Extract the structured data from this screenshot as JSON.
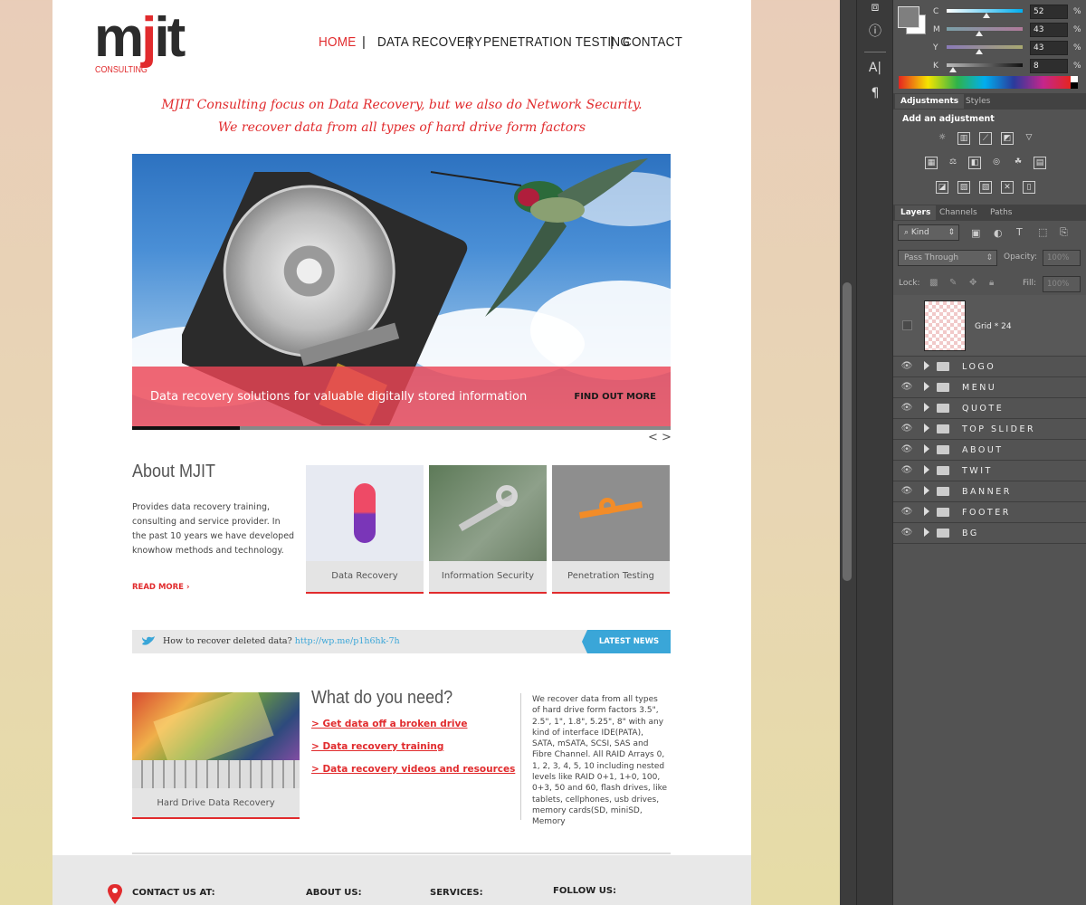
{
  "site": {
    "logo": {
      "main": "mjit",
      "sub": "CONSULTING"
    },
    "nav": [
      "HOME",
      "DATA RECOVERY",
      "PENETRATION TESTING",
      "CONTACT"
    ],
    "nav_separator": "|",
    "quote": [
      "MJIT Consulting focus on Data Recovery, but we also do Network Security.",
      "We recover data from all types of hard drive form factors"
    ],
    "slider": {
      "caption": "Data recovery solutions for valuable digitally stored information",
      "button": "FIND OUT MORE",
      "arrows": "< >",
      "progress": 0.2
    },
    "about": {
      "title": "About MJIT",
      "text": "Provides data recovery training, consulting and service provider. In the past 10 years we have developed knowhow methods and technology.",
      "read_more": "READ MORE",
      "tiles": [
        "Data Recovery",
        "Information Security",
        "Penetration Testing"
      ]
    },
    "twitter": {
      "text": "How to recover deleted data?",
      "link": "http://wp.me/p1h6hk-7h",
      "button": "LATEST NEWS"
    },
    "what": {
      "image_label": "Hard Drive Data Recovery",
      "title": "What do you need?",
      "links": [
        "> Get data off a broken drive",
        "> Data recovery training",
        "> Data recovery videos and resources"
      ],
      "body": "We recover data from all types of hard drive form factors 3.5\", 2.5\", 1\", 1.8\", 5.25\", 8\" with any kind of interface IDE(PATA), SATA, mSATA, SCSI, SAS and Fibre Channel. All RAID Arrays 0, 1, 2, 3, 4, 5, 10 including nested levels like RAID 0+1, 1+0, 100, 0+3, 50 and 60, flash drives, like tablets, cellphones, usb drives, memory cards(SD, miniSD, Memory"
    },
    "footer": [
      "CONTACT US AT:",
      "ABOUT US:",
      "SERVICES:",
      "FOLLOW US:"
    ]
  },
  "photoshop": {
    "color": {
      "channels": [
        {
          "label": "C",
          "value": "52",
          "level": 0.52
        },
        {
          "label": "M",
          "value": "43",
          "level": 0.43
        },
        {
          "label": "Y",
          "value": "43",
          "level": 0.43
        },
        {
          "label": "K",
          "value": "8",
          "level": 0.08
        }
      ],
      "unit": "%"
    },
    "adjustments": {
      "tabs": [
        "Adjustments",
        "Styles"
      ],
      "heading": "Add an adjustment"
    },
    "layers_panel": {
      "tabs": [
        "Layers",
        "Channels",
        "Paths"
      ],
      "kind": "Kind",
      "blend_mode": "Pass Through",
      "opacity_label": "Opacity:",
      "opacity_value": "100%",
      "lock_label": "Lock:",
      "fill_label": "Fill:",
      "fill_value": "100%",
      "grid_layer": "Grid * 24",
      "groups": [
        "LOGO",
        "MENU",
        "QUOTE",
        "TOP SLIDER",
        "ABOUT",
        "TWIT",
        "BANNER",
        "FOOTER",
        "BG"
      ]
    }
  }
}
